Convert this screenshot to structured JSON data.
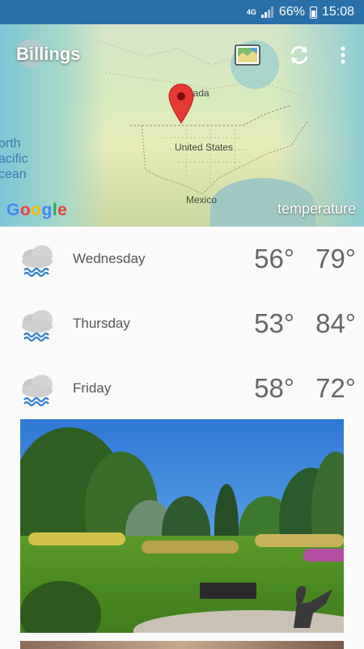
{
  "status_bar": {
    "network": "4G",
    "battery": "66%",
    "time": "15:08"
  },
  "header": {
    "city": "Billings",
    "overlay_label": "temperature",
    "map_labels": {
      "canada": "nada",
      "usa": "United States",
      "mexico": "Mexico",
      "ocean_line1": "orth",
      "ocean_line2": "acific",
      "ocean_line3": "cean"
    },
    "google_letters": [
      "G",
      "o",
      "o",
      "g",
      "l",
      "e"
    ]
  },
  "forecast": [
    {
      "day": "Wednesday",
      "low": "56°",
      "high": "79°",
      "icon": "rain-cloud-icon"
    },
    {
      "day": "Thursday",
      "low": "53°",
      "high": "84°",
      "icon": "rain-cloud-icon"
    },
    {
      "day": "Friday",
      "low": "58°",
      "high": "72°",
      "icon": "rain-cloud-icon"
    }
  ],
  "colors": {
    "status_bar": "#2b6fa8",
    "rain": "#2f7fd1"
  }
}
